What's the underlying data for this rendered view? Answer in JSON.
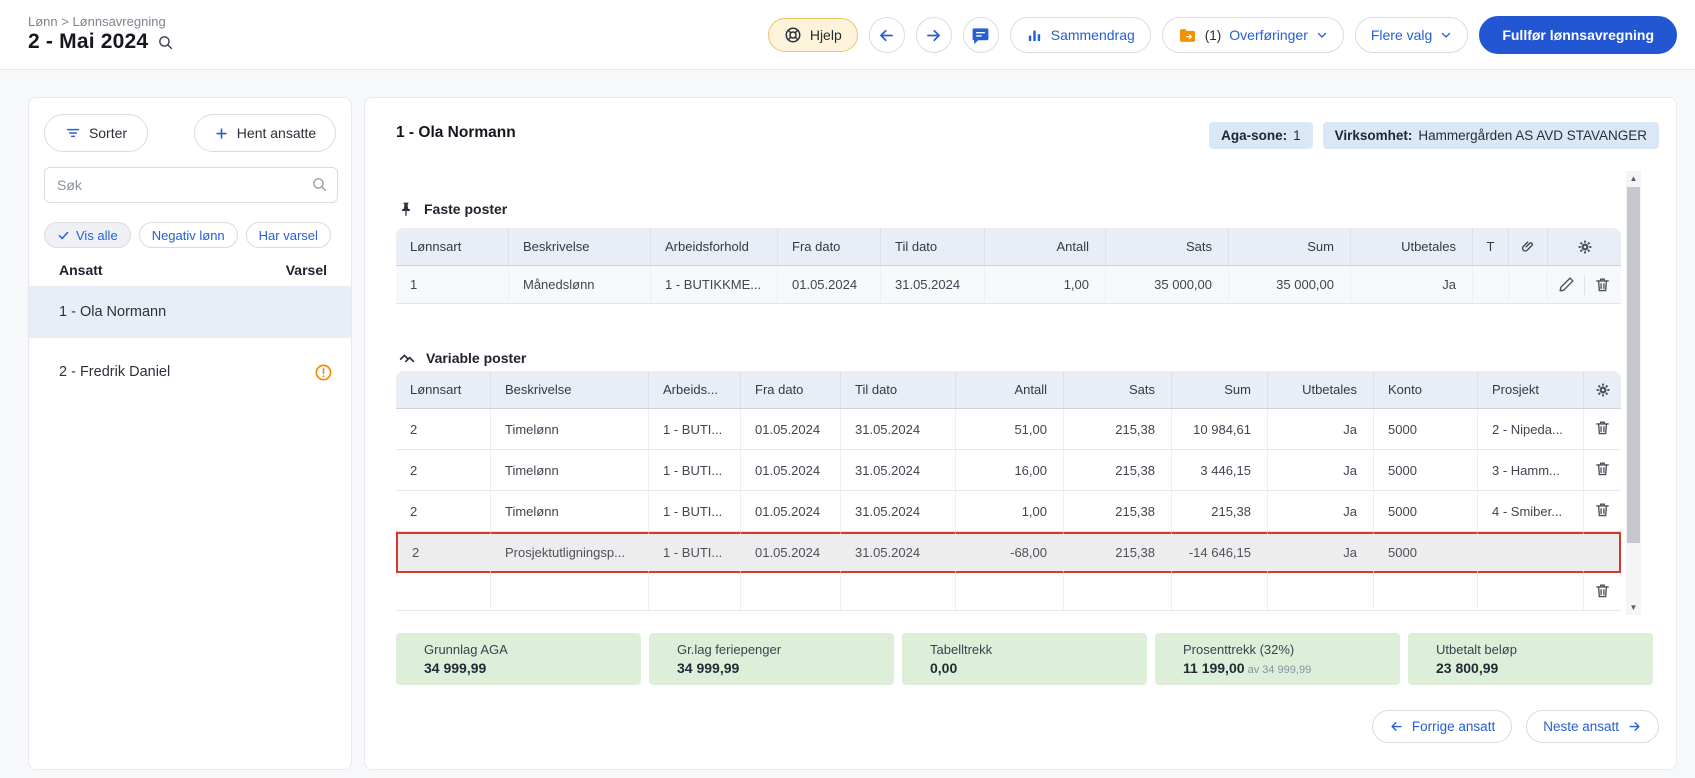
{
  "header": {
    "breadcrumb": "Lønn > Lønnsavregning",
    "title": "2 - Mai 2024",
    "hjelp": "Hjelp",
    "sammendrag": "Sammendrag",
    "overforinger_count": "(1)",
    "overforinger": "Overføringer",
    "flere_valg": "Flere valg",
    "fullfor": "Fullfør lønnsavregning"
  },
  "sidebar": {
    "sorter": "Sorter",
    "hent_ansatte": "Hent ansatte",
    "sok_placeholder": "Søk",
    "filters": [
      "Vis alle",
      "Negativ lønn",
      "Har varsel"
    ],
    "col_ansatt": "Ansatt",
    "col_varsel": "Varsel",
    "employees": [
      {
        "name": "1 - Ola Normann",
        "selected": true,
        "warning": false
      },
      {
        "name": "2 - Fredrik Daniel",
        "selected": false,
        "warning": true
      }
    ]
  },
  "main": {
    "employee_title": "1 - Ola Normann",
    "aga_label": "Aga-sone:",
    "aga_value": "1",
    "virksomhet_label": "Virksomhet:",
    "virksomhet_value": "Hammergården AS AVD STAVANGER",
    "faste": {
      "title": "Faste poster",
      "headers": [
        "Lønnsart",
        "Beskrivelse",
        "Arbeidsforhold",
        "Fra dato",
        "Til dato",
        "Antall",
        "Sats",
        "Sum",
        "Utbetales",
        "T"
      ],
      "rows": [
        [
          "1",
          "Månedslønn",
          "1 - BUTIKKME...",
          "01.05.2024",
          "31.05.2024",
          "1,00",
          "35 000,00",
          "35 000,00",
          "Ja",
          ""
        ]
      ]
    },
    "variable": {
      "title": "Variable poster",
      "headers": [
        "Lønnsart",
        "Beskrivelse",
        "Arbeids...",
        "Fra dato",
        "Til dato",
        "Antall",
        "Sats",
        "Sum",
        "Utbetales",
        "Konto",
        "Prosjekt"
      ],
      "rows": [
        [
          "2",
          "Timelønn",
          "1 - BUTI...",
          "01.05.2024",
          "31.05.2024",
          "51,00",
          "215,38",
          "10 984,61",
          "Ja",
          "5000",
          "2 - Nipeda..."
        ],
        [
          "2",
          "Timelønn",
          "1 - BUTI...",
          "01.05.2024",
          "31.05.2024",
          "16,00",
          "215,38",
          "3 446,15",
          "Ja",
          "5000",
          "3 - Hamm..."
        ],
        [
          "2",
          "Timelønn",
          "1 - BUTI...",
          "01.05.2024",
          "31.05.2024",
          "1,00",
          "215,38",
          "215,38",
          "Ja",
          "5000",
          "4 - Smiber..."
        ],
        [
          "2",
          "Prosjektutligningsp...",
          "1 - BUTI...",
          "01.05.2024",
          "31.05.2024",
          "-68,00",
          "215,38",
          "-14 646,15",
          "Ja",
          "5000",
          ""
        ]
      ],
      "highlighted_row": 3
    },
    "summary": [
      {
        "label": "Grunnlag AGA",
        "value": "34 999,99"
      },
      {
        "label": "Gr.lag feriepenger",
        "value": "34 999,99"
      },
      {
        "label": "Tabelltrekk",
        "value": "0,00"
      },
      {
        "label": "Prosenttrekk (32%)",
        "value": "11 199,00",
        "suffix": "av 34 999,99"
      },
      {
        "label": "Utbetalt beløp",
        "value": "23 800,99"
      }
    ],
    "nav": {
      "prev": "Forrige ansatt",
      "next": "Neste ansatt"
    }
  },
  "colors": {
    "accent_blue": "#2356d3",
    "link_blue": "#2660d4",
    "warning_orange": "#ef8e00",
    "folder_orange": "#f39200",
    "highlight_red": "#d6392b",
    "summary_green": "#ddefd8",
    "badge_blue": "#d9e7f7",
    "table_header": "#e9edf6"
  }
}
